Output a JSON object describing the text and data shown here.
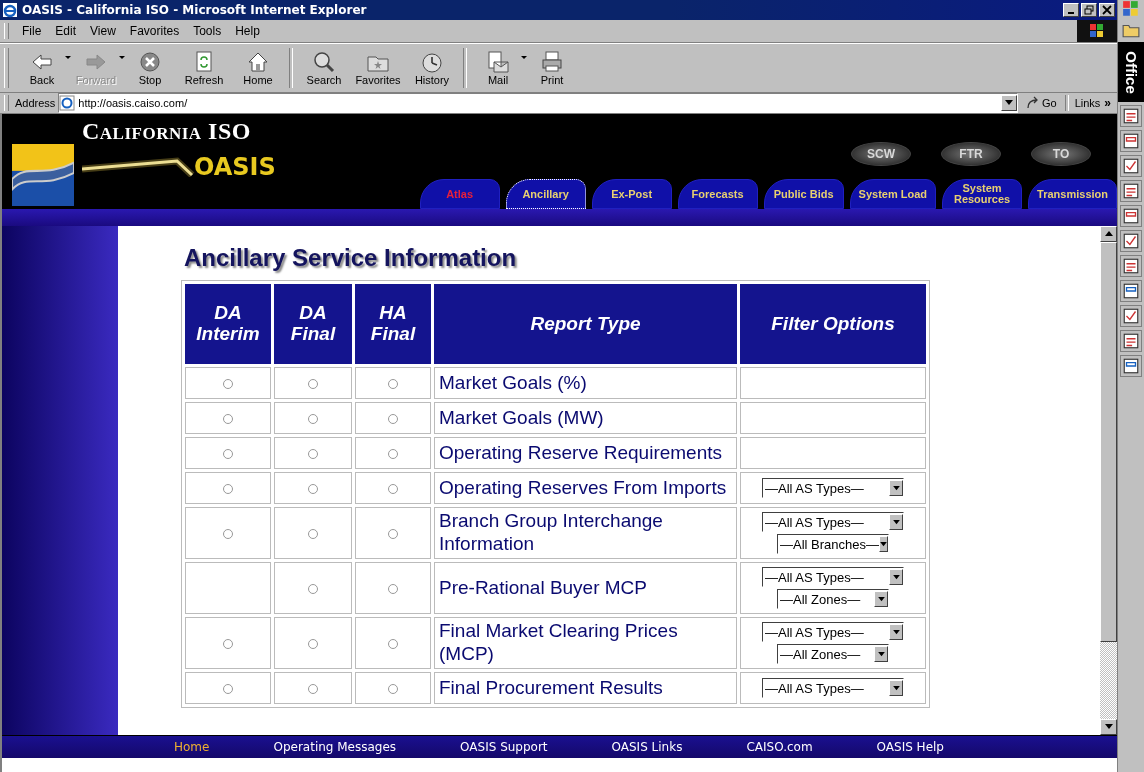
{
  "window": {
    "title": "OASIS - California ISO - Microsoft Internet Explorer"
  },
  "menu": [
    "File",
    "Edit",
    "View",
    "Favorites",
    "Tools",
    "Help"
  ],
  "toolbar": [
    {
      "kind": "back",
      "label": "Back",
      "disabled": false,
      "dropdown": true
    },
    {
      "kind": "forward",
      "label": "Forward",
      "disabled": true,
      "dropdown": true
    },
    {
      "kind": "stop",
      "label": "Stop",
      "disabled": false,
      "dropdown": false
    },
    {
      "kind": "refresh",
      "label": "Refresh",
      "disabled": false,
      "dropdown": false
    },
    {
      "kind": "home",
      "label": "Home",
      "disabled": false,
      "dropdown": false
    },
    {
      "kind": "search",
      "label": "Search",
      "disabled": false,
      "dropdown": false
    },
    {
      "kind": "favorites",
      "label": "Favorites",
      "disabled": false,
      "dropdown": false
    },
    {
      "kind": "history",
      "label": "History",
      "disabled": false,
      "dropdown": false
    },
    {
      "kind": "mail",
      "label": "Mail",
      "disabled": false,
      "dropdown": true
    },
    {
      "kind": "print",
      "label": "Print",
      "disabled": false,
      "dropdown": false
    }
  ],
  "address": {
    "label": "Address",
    "value": "http://oasis.caiso.com/",
    "go": "Go",
    "links": "Links",
    "links_more": "»"
  },
  "site": {
    "org": "California ISO",
    "product": "OASIS",
    "ovals": [
      "SCW",
      "FTR",
      "TO"
    ],
    "tabs": [
      {
        "lines": [
          "Atlas"
        ],
        "highlighted": true,
        "focused": false
      },
      {
        "lines": [
          "Ancillary"
        ],
        "highlighted": false,
        "focused": true
      },
      {
        "lines": [
          "Ex-Post"
        ],
        "highlighted": false,
        "focused": false
      },
      {
        "lines": [
          "Forecasts"
        ],
        "highlighted": false,
        "focused": false
      },
      {
        "lines": [
          "Public Bids"
        ],
        "highlighted": false,
        "focused": false
      },
      {
        "lines": [
          "System Load"
        ],
        "highlighted": false,
        "focused": false
      },
      {
        "lines": [
          "System",
          "Resources"
        ],
        "highlighted": false,
        "focused": false
      },
      {
        "lines": [
          "Transmission"
        ],
        "highlighted": false,
        "focused": false
      }
    ]
  },
  "heading": "Ancillary Service Information",
  "table": {
    "columns": [
      [
        "DA",
        "Interim"
      ],
      [
        "DA",
        "Final"
      ],
      [
        "HA",
        "Final"
      ],
      [
        "Report Type"
      ],
      [
        "Filter Options"
      ]
    ],
    "rows": [
      {
        "radios": [
          {
            "selected": false
          },
          {
            "selected": false
          },
          {
            "selected": false
          }
        ],
        "report": "Market Goals (%)",
        "filters": []
      },
      {
        "radios": [
          {
            "selected": false
          },
          {
            "selected": false
          },
          {
            "selected": false
          }
        ],
        "report": "Market Goals (MW)",
        "filters": []
      },
      {
        "radios": [
          {
            "selected": false
          },
          {
            "selected": false
          },
          {
            "selected": false
          }
        ],
        "report": "Operating Reserve Requirements",
        "filters": []
      },
      {
        "radios": [
          {
            "selected": false
          },
          {
            "selected": false
          },
          {
            "selected": false
          }
        ],
        "report": "Operating Reserves From Imports",
        "filters": [
          "—All AS Types—"
        ]
      },
      {
        "radios": [
          {
            "selected": false
          },
          {
            "selected": false
          },
          {
            "selected": false
          }
        ],
        "report": "Branch Group Interchange Information",
        "filters": [
          "—All AS Types—",
          "—All Branches—"
        ]
      },
      {
        "radios": [
          {
            "kind": "empty"
          },
          {
            "selected": false
          },
          {
            "selected": false
          }
        ],
        "report": "Pre-Rational Buyer MCP",
        "filters": [
          "—All AS Types—",
          "—All Zones—"
        ]
      },
      {
        "radios": [
          {
            "selected": false
          },
          {
            "selected": false
          },
          {
            "selected": false
          }
        ],
        "report": "Final Market Clearing Prices (MCP)",
        "filters": [
          "—All AS Types—",
          "—All Zones—"
        ]
      },
      {
        "radios": [
          {
            "selected": false
          },
          {
            "selected": false
          },
          {
            "selected": false
          }
        ],
        "report": "Final Procurement Results",
        "filters": [
          "—All AS Types—"
        ]
      }
    ]
  },
  "footer": [
    {
      "label": "Home",
      "selected": true
    },
    {
      "label": "Operating Messages",
      "selected": false
    },
    {
      "label": "OASIS Support",
      "selected": false
    },
    {
      "label": "OASIS Links",
      "selected": false
    },
    {
      "label": "CAISO.com",
      "selected": false
    },
    {
      "label": "OASIS Help",
      "selected": false
    }
  ],
  "office_bar": {
    "title": "Office"
  }
}
